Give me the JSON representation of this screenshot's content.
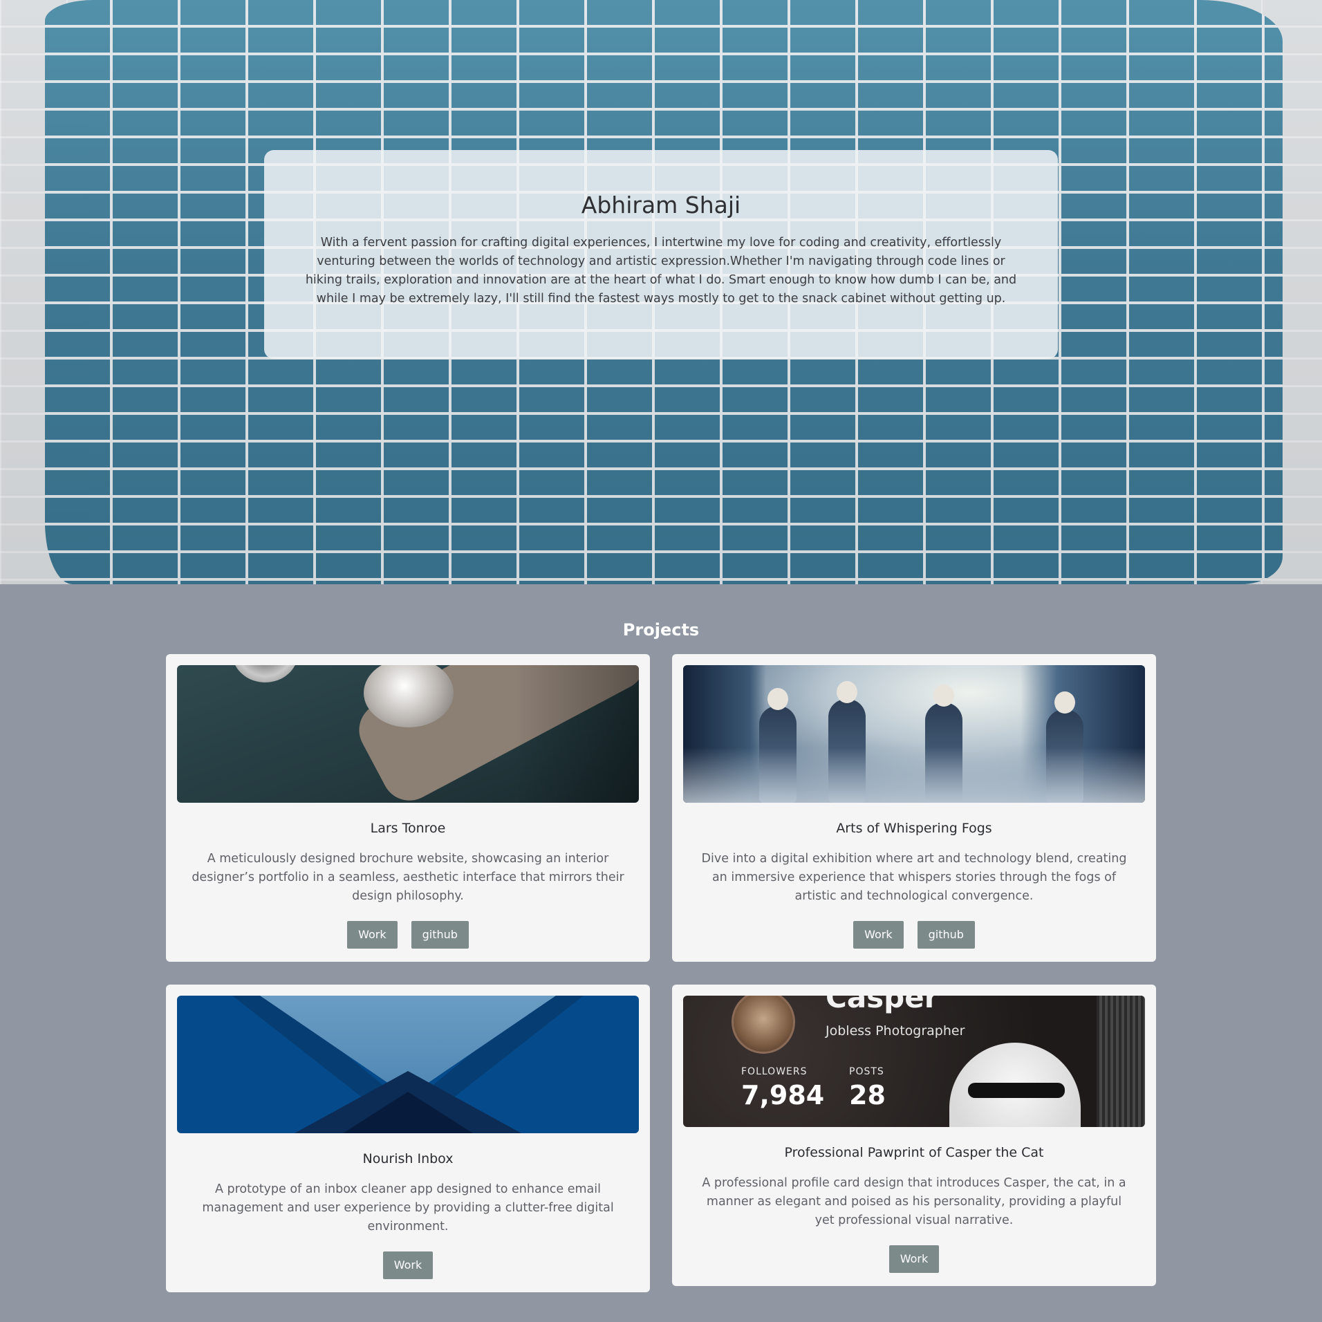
{
  "intro": {
    "name": "Abhiram Shaji",
    "bio": "With a fervent passion for crafting digital experiences, I intertwine my love for coding and creativity, effortlessly venturing between the worlds of technology and artistic expression.Whether I'm navigating through code lines or hiking trails, exploration and innovation are at the heart of what I do. Smart enough to know how dumb I can be, and while I may be extremely lazy, I'll still find the fastest ways mostly to get to the snack cabinet without getting up."
  },
  "projects": {
    "title": "Projects",
    "items": [
      {
        "title": "Lars Tonroe",
        "description": "A meticulously designed brochure website, showcasing an interior designer’s portfolio in a seamless, aesthetic interface that mirrors their design philosophy.",
        "buttons": [
          "Work",
          "github"
        ]
      },
      {
        "title": "Arts of Whispering Fogs",
        "description": "Dive into a digital exhibition where art and technology blend, creating an immersive experience that whispers stories through the fogs of artistic and technological convergence.",
        "buttons": [
          "Work",
          "github"
        ]
      },
      {
        "title": "Nourish Inbox",
        "description": "A prototype of an inbox cleaner app designed to enhance email management and user experience by providing a clutter-free digital environment.",
        "buttons": [
          "Work"
        ]
      },
      {
        "title": "Professional Pawprint of Casper the Cat",
        "description": "A professional profile card design that introduces Casper, the cat, in a manner as elegant and poised as his personality, providing a playful yet professional visual narrative.",
        "buttons": [
          "Work"
        ],
        "image_text": {
          "name": "Casper",
          "subtitle": "Jobless Photographer",
          "followers_label": "FOLLOWERS",
          "followers": "7,984",
          "posts_label": "POSTS",
          "posts": "28"
        }
      }
    ]
  },
  "colors": {
    "page_bg": "#9097a3",
    "card_bg": "#f5f5f6",
    "button_bg": "#7d8a8a",
    "wall_blue": "#3f7f9c"
  }
}
